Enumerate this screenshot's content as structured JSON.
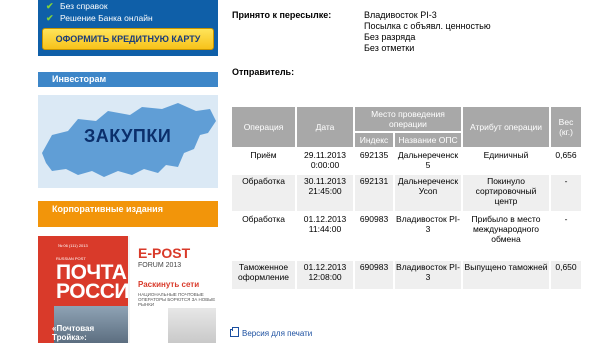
{
  "sidebar": {
    "banner": {
      "items": [
        "Без справок",
        "Решение Банка онлайн"
      ],
      "button_label": "ОФОРМИТЬ КРЕДИТНУЮ КАРТУ"
    },
    "investors_label": "Инвесторам",
    "procurement_label": "ЗАКУПКИ",
    "corporate_label": "Корпоративные издания",
    "magazine": {
      "issue": "№ 06 (111) 2013",
      "brand_small": "RUSSIAN POST",
      "title_line1": "ПОЧТА",
      "title_line2": "РОССИИ",
      "epost": "E-POST",
      "forum": "FORUM 2013",
      "headline": "Раскинуть сети",
      "subtext": "НАЦИОНАЛЬНЫЕ ПОЧТОВЫЕ ОПЕРАТОРЫ БОРЮТСЯ ЗА НОВЫЕ РЫНКИ",
      "troyka": "«Почтовая Тройка»: значение"
    }
  },
  "details": {
    "accepted_label": "Принято к пересылке:",
    "accepted_values": [
      "Владивосток PI-3",
      "Посылка с объявл. ценностью",
      "Без разряда",
      "Без отметки"
    ],
    "sender_label": "Отправитель:"
  },
  "table": {
    "headers": {
      "operation": "Операция",
      "date": "Дата",
      "place": "Место проведения операции",
      "index": "Индекс",
      "ops_name": "Название ОПС",
      "attribute": "Атрибут операции",
      "weight": "Вес (кг.)"
    },
    "rows": [
      {
        "operation": "Приём",
        "date": "29.11.2013 0:00:00",
        "index": "692135",
        "ops_name": "Дальнереченск 5",
        "attribute": "Единичный",
        "weight": "0,656"
      },
      {
        "operation": "Обработка",
        "date": "30.11.2013 21:45:00",
        "index": "692131",
        "ops_name": "Дальнереченск Усоп",
        "attribute": "Покинуло сортировочный центр",
        "weight": "-"
      },
      {
        "operation": "Обработка",
        "date": "01.12.2013 11:44:00",
        "index": "690983",
        "ops_name": "Владивосток PI-3",
        "attribute": "Прибыло в место международного обмена",
        "weight": "-"
      },
      {
        "operation": "Таможенное оформление",
        "date": "01.12.2013 12:08:00",
        "index": "690983",
        "ops_name": "Владивосток PI-3",
        "attribute": "Выпущено таможней",
        "weight": "0,650"
      }
    ]
  },
  "print_label": "Версия для печати"
}
